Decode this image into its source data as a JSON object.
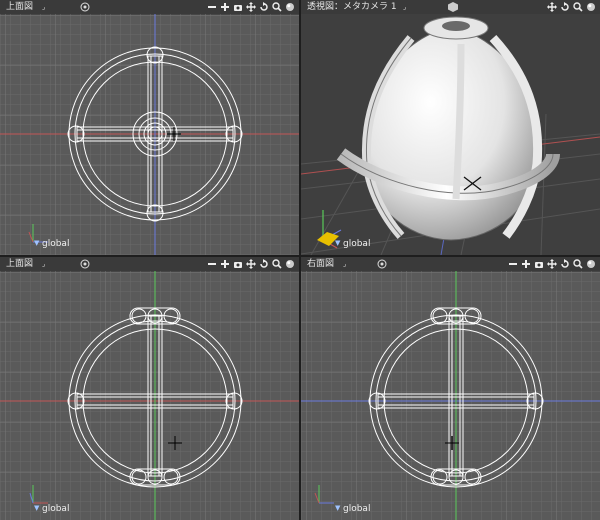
{
  "viewports": {
    "top_left": {
      "title": "上面図",
      "dropdown": "⌟",
      "global": "global"
    },
    "top_right": {
      "title": "透視図：メタカメラ 1",
      "dropdown": "⌟",
      "global": "global"
    },
    "bottom_left": {
      "title": "上面図",
      "dropdown": "⌟",
      "global": "global"
    },
    "bottom_right": {
      "title": "右面図",
      "dropdown": "⌟",
      "global": "global"
    }
  },
  "colors": {
    "grid_bg": "#5a5a5a",
    "wire": "#ffffff",
    "x_axis": "#d05050",
    "y_axis": "#50c050",
    "z_axis": "#6a7adf"
  },
  "icons": [
    "target-icon",
    "minus-icon",
    "plus-icon",
    "camera-icon",
    "move-icon",
    "rotate-icon",
    "zoom-icon",
    "sphere-icon"
  ]
}
